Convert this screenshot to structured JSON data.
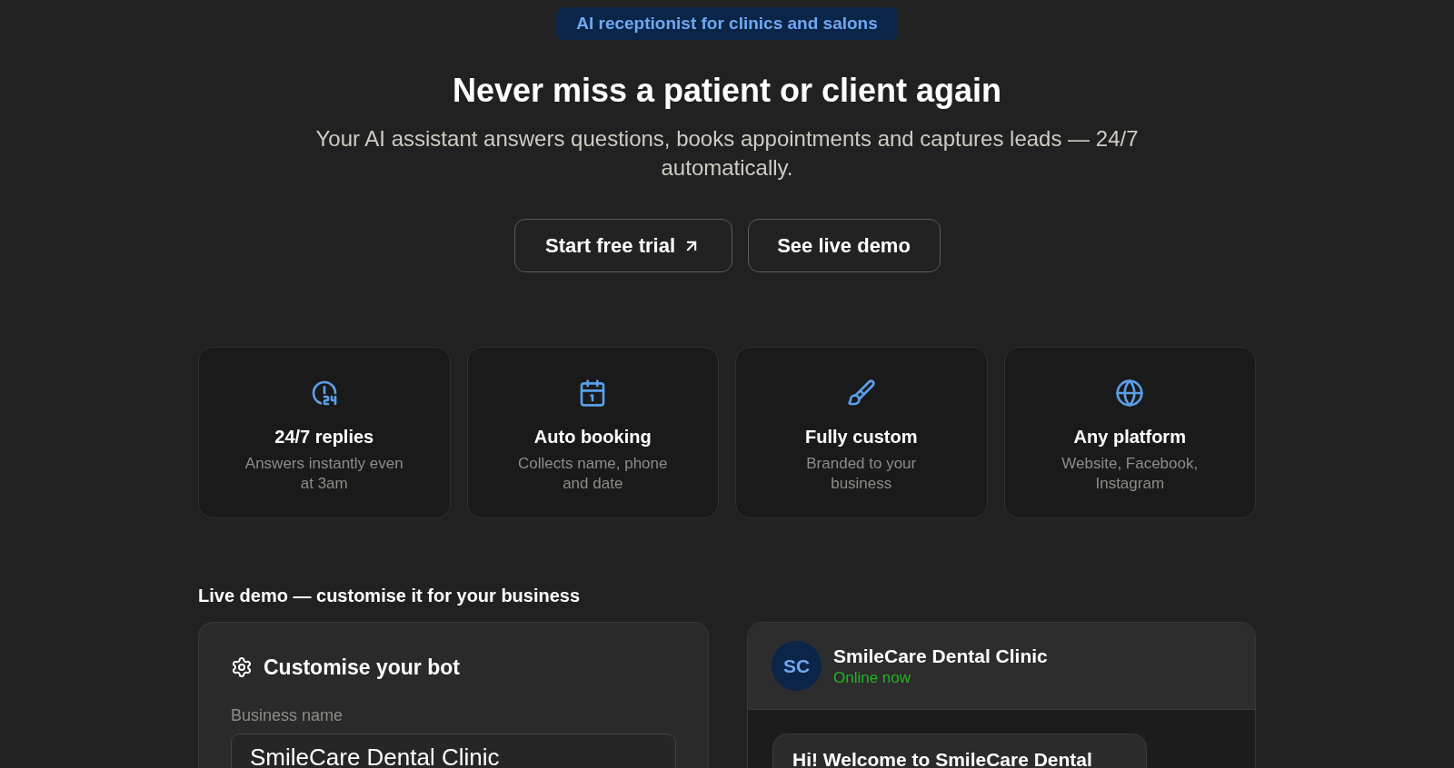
{
  "hero": {
    "badge": "AI receptionist for clinics and salons",
    "title": "Never miss a patient or client again",
    "subtitle": "Your AI assistant answers questions, books appointments and captures leads — 24/7 automatically.",
    "buttons": [
      {
        "label": "Start free trial",
        "kind": "external"
      },
      {
        "label": "See live demo",
        "kind": "plain"
      }
    ]
  },
  "features": [
    {
      "title": "24/7 replies",
      "description": "Answers instantly even at 3am"
    },
    {
      "title": "Auto booking",
      "description": "Collects name, phone and date"
    },
    {
      "title": "Fully custom",
      "description": "Branded to your business"
    },
    {
      "title": "Any platform",
      "description": "Website, Facebook, Instagram"
    }
  ],
  "demo": {
    "heading": "Live demo — customise it for your business",
    "customiser": {
      "title": "Customise your bot",
      "fields": [
        {
          "label": "Business name",
          "value": "SmileCare Dental Clinic"
        }
      ]
    },
    "chat": {
      "avatar": "SC",
      "name": "SmileCare Dental Clinic",
      "status": "Online now",
      "messages": [
        {
          "kind": "incoming",
          "text": "Hi! Welcome to SmileCare Dental"
        }
      ]
    }
  }
}
